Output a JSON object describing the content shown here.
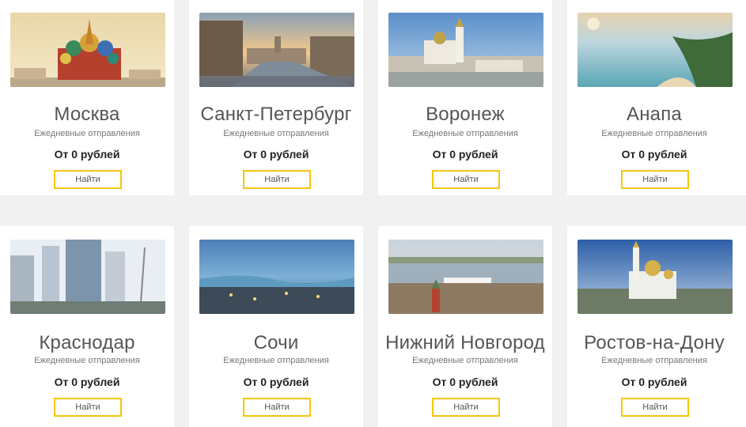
{
  "cards": [
    {
      "city": "Москва",
      "subtitle": "Ежедневные отправления",
      "price": "От 0 рублей",
      "button": "Найти"
    },
    {
      "city": "Санкт-Петербург",
      "subtitle": "Ежедневные отправления",
      "price": "От 0 рублей",
      "button": "Найти"
    },
    {
      "city": "Воронеж",
      "subtitle": "Ежедневные отправления",
      "price": "От 0 рублей",
      "button": "Найти"
    },
    {
      "city": "Анапа",
      "subtitle": "Ежедневные отправления",
      "price": "От 0 рублей",
      "button": "Найти"
    },
    {
      "city": "Краснодар",
      "subtitle": "Ежедневные отправления",
      "price": "От 0 рублей",
      "button": "Найти"
    },
    {
      "city": "Сочи",
      "subtitle": "Ежедневные отправления",
      "price": "От 0 рублей",
      "button": "Найти"
    },
    {
      "city": "Нижний Новгород",
      "subtitle": "Ежедневные отправления",
      "price": "От 0 рублей",
      "button": "Найти"
    },
    {
      "city": "Ростов-на-Дону",
      "subtitle": "Ежедневные отправления",
      "price": "От 0 рублей",
      "button": "Найти"
    }
  ],
  "colors": {
    "accent": "#f5c60c",
    "page_background": "#f1f1f1",
    "card_background": "#ffffff"
  }
}
